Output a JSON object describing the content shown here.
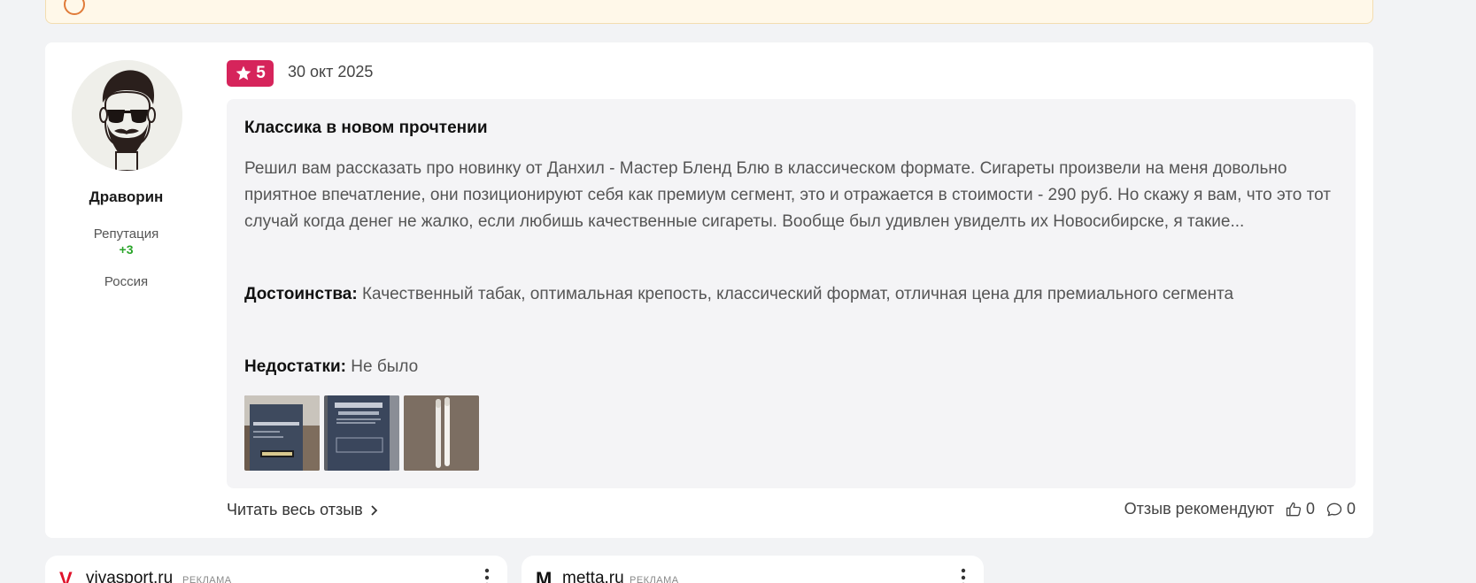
{
  "review": {
    "author": {
      "name": "Драворин",
      "reputation_label": "Репутация",
      "reputation_value": "+3",
      "country": "Россия"
    },
    "rating": "5",
    "date": "30 окт 2025",
    "title": "Классика в новом прочтении",
    "body": "Решил вам рассказать про новинку от Данхил - Мастер Бленд Блю в классическом формате. Сигареты произвели на меня довольно приятное впечатление, они позиционируют себя как премиум сегмент, это и отражается в стоимости - 290 руб. Но скажу я вам, что это тот случай когда денег не жалко, если любишь качественные сигареты. Вообще был удивлен увиделть их Новосибирске, я такие...",
    "pros_label": "Достоинства:",
    "pros_text": "Качественный табак, оптимальная крепость, классический формат, отличная цена для премиального сегмента",
    "cons_label": "Недостатки:",
    "cons_text": "Не было",
    "read_more": "Читать весь отзыв",
    "recommend_label": "Отзыв рекомендуют",
    "likes": "0",
    "comments": "0"
  },
  "ads": [
    {
      "domain": "vivasport.ru",
      "tag": "РЕКЛАМА",
      "logo": "V"
    },
    {
      "domain": "metta.ru",
      "tag": "РЕКЛАМА",
      "logo": "M"
    }
  ],
  "colors": {
    "rating_badge": "#d6245b",
    "reputation_positive": "#2aa52a",
    "bubble_bg": "#f4f4f6",
    "page_bg": "#f2f3f5"
  }
}
